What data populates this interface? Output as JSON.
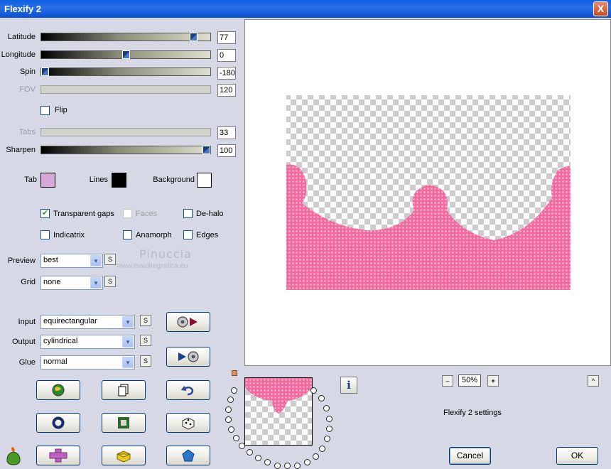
{
  "window": {
    "title": "Flexify 2",
    "close_label": "X"
  },
  "sliders": [
    {
      "label": "Latitude",
      "value": "77",
      "disabled": false
    },
    {
      "label": "Longitude",
      "value": "0",
      "disabled": false
    },
    {
      "label": "Spin",
      "value": "-180",
      "disabled": false
    },
    {
      "label": "FOV",
      "value": "120",
      "disabled": true
    },
    {
      "label": "Tabs",
      "value": "33",
      "disabled": true
    },
    {
      "label": "Sharpen",
      "value": "100",
      "disabled": false
    }
  ],
  "flip": {
    "label": "Flip",
    "checked": false
  },
  "colors": {
    "tab_label": "Tab",
    "tab_color": "#d8a8d8",
    "lines_label": "Lines",
    "lines_color": "#000000",
    "background_label": "Background",
    "background_color": "#ffffff"
  },
  "options": {
    "transparent_gaps": "Transparent gaps",
    "faces": "Faces",
    "de_halo": "De-halo",
    "indicatrix": "Indicatrix",
    "anamorph": "Anamorph",
    "edges": "Edges"
  },
  "preview_select": {
    "label": "Preview",
    "value": "best"
  },
  "grid_select": {
    "label": "Grid",
    "value": "none"
  },
  "input_select": {
    "label": "Input",
    "value": "equirectangular"
  },
  "output_select": {
    "label": "Output",
    "value": "cylindrical"
  },
  "glue_select": {
    "label": "Glue",
    "value": "normal"
  },
  "s_label": "S",
  "zoom": {
    "minus": "–",
    "value": "50%",
    "plus": "+",
    "up": "^"
  },
  "info_label": "i",
  "settings_label": "Flexify 2 settings",
  "watermark": {
    "name": "Pinuccia",
    "url": "www.maidiregrafica.eu"
  },
  "buttons": {
    "cancel": "Cancel",
    "ok": "OK"
  }
}
